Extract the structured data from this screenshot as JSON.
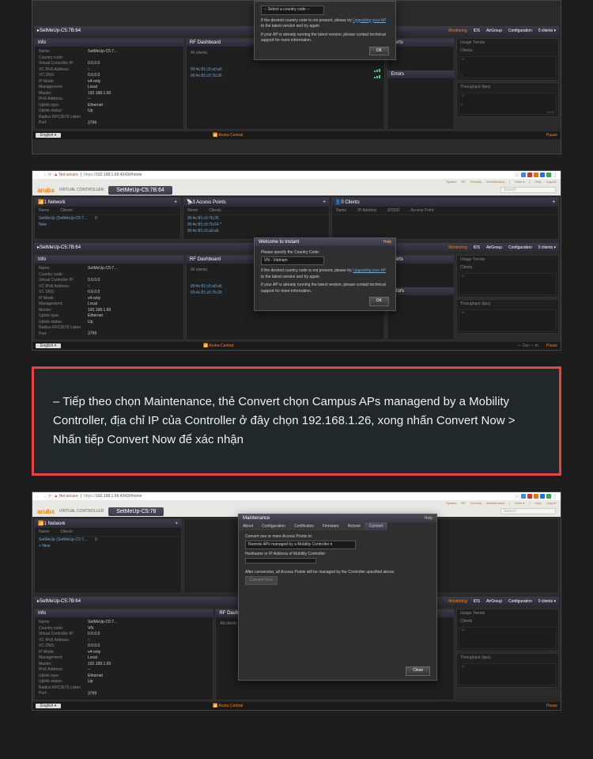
{
  "url": "192.168.1.69:4343/#home",
  "secure_label": "Not secure",
  "url_prefix": "https://",
  "brand": "aruba",
  "vc_label": "VIRTUAL CONTROLLER",
  "ssid": "SetMeUp-C5:7B:64",
  "search_placeholder": "Search",
  "top_nav": {
    "system": "System",
    "rf": "RF",
    "security": "Security",
    "maintenance": "Maintenance",
    "more": "More ▾",
    "help": "Help",
    "logout": "Logout"
  },
  "network": {
    "title": "1 Network",
    "col_name": "Name",
    "col_clients": "Clients",
    "item": "SetMeUp (SetMeUp-C5:7...",
    "count": "0",
    "new": "New"
  },
  "aps": {
    "title": "3 Access Points",
    "col_name": "Name",
    "col_clients": "Clients",
    "list": [
      "90:4c:81:c5:7b:26",
      "90:4c:81:c5:7b:64 *",
      "90:4c:81:c5:a0:a6"
    ]
  },
  "clients": {
    "title": "0 Clients",
    "cols": {
      "name": "Name",
      "ip": "IP Address",
      "essid": "ESSID",
      "ap": "Access Point"
    }
  },
  "detail_tabs": {
    "monitoring": "Monitoring",
    "ids": "IDS",
    "airgroup": "AirGroup",
    "config": "Configuration",
    "n_clients": "0 clients ▾"
  },
  "info_title": "Info",
  "info": [
    {
      "k": "Name:",
      "v": "SetMeUp-C5:7..."
    },
    {
      "k": "Country code:",
      "v": ""
    },
    {
      "k": "Virtual Controller IP:",
      "v": "0.0.0.0"
    },
    {
      "k": "VC IPv6 Address:",
      "v": "::"
    },
    {
      "k": "VC DNS:",
      "v": "0.0.0.0"
    },
    {
      "k": "IP Mode:",
      "v": "v4-only"
    },
    {
      "k": "Management:",
      "v": "Local"
    },
    {
      "k": "Master:",
      "v": "192.168.1.69"
    },
    {
      "k": "IPv6 Address:",
      "v": "--"
    },
    {
      "k": "Uplink type:",
      "v": "Ethernet"
    },
    {
      "k": "Uplink status:",
      "v": "Up"
    },
    {
      "k": "Radius RFC3576 Listen Port:",
      "v": "3799"
    }
  ],
  "info_vn": [
    {
      "k": "Name:",
      "v": "SetMeUp-C5:7..."
    },
    {
      "k": "Country code:",
      "v": "VN"
    },
    {
      "k": "Virtual Controller IP:",
      "v": "0.0.0.0"
    },
    {
      "k": "VC IPv6 Address:",
      "v": "::"
    },
    {
      "k": "VC DNS:",
      "v": "0.0.0.0"
    },
    {
      "k": "IP Mode:",
      "v": "v4-only"
    },
    {
      "k": "Management:",
      "v": "Local"
    },
    {
      "k": "Master:",
      "v": "192.168.1.69"
    },
    {
      "k": "IPv6 Address:",
      "v": "--"
    },
    {
      "k": "Uplink type:",
      "v": "Ethernet"
    },
    {
      "k": "Uplink status:",
      "v": "Up"
    },
    {
      "k": "Radius RFC3576 Listen Port:",
      "v": "3799"
    }
  ],
  "rf": {
    "title": "RF Dashboard",
    "all_clients": "All clients",
    "ap1": "90:4c:81:c5:a0:a6",
    "ap2": "90:4c:81:c5:7b:26"
  },
  "alerts_title": "Alerts",
  "errors_title": "Errors",
  "usage": {
    "title": "Usage Trends",
    "clients": "Clients",
    "throughput": "Throughput   (bps)",
    "zero": "0",
    "ten": "10",
    "time": "19:50"
  },
  "footer": {
    "lang": "English ▾",
    "aruba_central": "Aruba Central",
    "pause": "Pause",
    "out": "Out",
    "in": "In"
  },
  "modal_welcome": {
    "title": "Welcome to Instant",
    "help": "Help",
    "prompt": "Please specify the Country Code:",
    "select_placeholder": "-- Select a country code --",
    "select_vn": "VN - Vietnam",
    "line1a": "If the desired country code is not present, please try ",
    "line1_link": "Upgrading your AP",
    "line1b": " to the latest version and try again.",
    "line2": "If your AP is already running the latest version, please contact technical support for more information.",
    "ok": "OK"
  },
  "modal_maint": {
    "title": "Maintenance",
    "help": "Help",
    "tabs": {
      "about": "About",
      "config": "Configuration",
      "certs": "Certificates",
      "firmware": "Firmware",
      "reboot": "Reboot",
      "convert": "Convert"
    },
    "prompt": "Convert one or more Access Points to:",
    "select": "Remote APs managed by a Mobility Controller",
    "label": "Hostname or IP Address of Mobility Controller:",
    "note": "After conversion, all Access Points will be managed by the Controller specified above.",
    "convert_btn": "Convert Now",
    "close": "Close"
  },
  "callout_text": "– Tiếp theo chọn Maintenance, thẻ Convert chọn Campus APs managend by a Mobility Controller, địa chỉ IP của Controller ở đây chọn 192.168.1.26, xong nhấn Convert Now > Nhấn tiếp Convert Now để xác nhận"
}
